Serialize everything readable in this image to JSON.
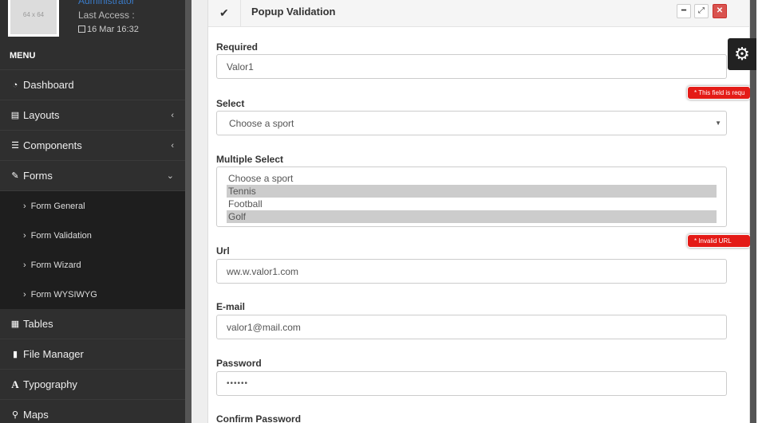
{
  "user": {
    "avatar_text": "64 x 64",
    "role": "Administrator",
    "last_access_label": "Last Access :",
    "last_access_date": "16 Mar 16:32"
  },
  "menu": {
    "title": "MENU",
    "items": [
      {
        "label": "Dashboard",
        "icon": "dashboard-icon"
      },
      {
        "label": "Layouts",
        "icon": "layouts-icon"
      },
      {
        "label": "Components",
        "icon": "components-icon"
      },
      {
        "label": "Forms",
        "icon": "pencil-icon"
      }
    ],
    "forms_sub": [
      {
        "label": "Form General"
      },
      {
        "label": "Form Validation"
      },
      {
        "label": "Form Wizard"
      },
      {
        "label": "Form WYSIWYG"
      }
    ],
    "items_after": [
      {
        "label": "Tables",
        "icon": "table-icon"
      },
      {
        "label": "File Manager",
        "icon": "file-icon"
      },
      {
        "label": "Typography",
        "icon": "font-icon"
      },
      {
        "label": "Maps",
        "icon": "map-marker-icon"
      }
    ]
  },
  "panel": {
    "title": "Popup Validation",
    "fields": {
      "required": {
        "label": "Required",
        "value": "Valor1"
      },
      "select": {
        "label": "Select",
        "value": "Choose a sport"
      },
      "multiple": {
        "label": "Multiple Select",
        "options": [
          {
            "label": "Choose a sport",
            "selected": false
          },
          {
            "label": "Tennis",
            "selected": true
          },
          {
            "label": "Football",
            "selected": false
          },
          {
            "label": "Golf",
            "selected": true
          }
        ]
      },
      "url": {
        "label": "Url",
        "value": "ww.w.valor1.com"
      },
      "email": {
        "label": "E-mail",
        "value": "valor1@mail.com"
      },
      "password": {
        "label": "Password",
        "value": "••••••"
      },
      "confirm_password": {
        "label": "Confirm Password"
      }
    },
    "errors": {
      "select": "* This field is requ",
      "url": "* Invalid URL"
    }
  },
  "colors": {
    "sidebar_bg": "#2f2f2f",
    "submenu_bg": "#1e1e1e",
    "error_red": "#e41b17",
    "close_red": "#d9534f"
  }
}
